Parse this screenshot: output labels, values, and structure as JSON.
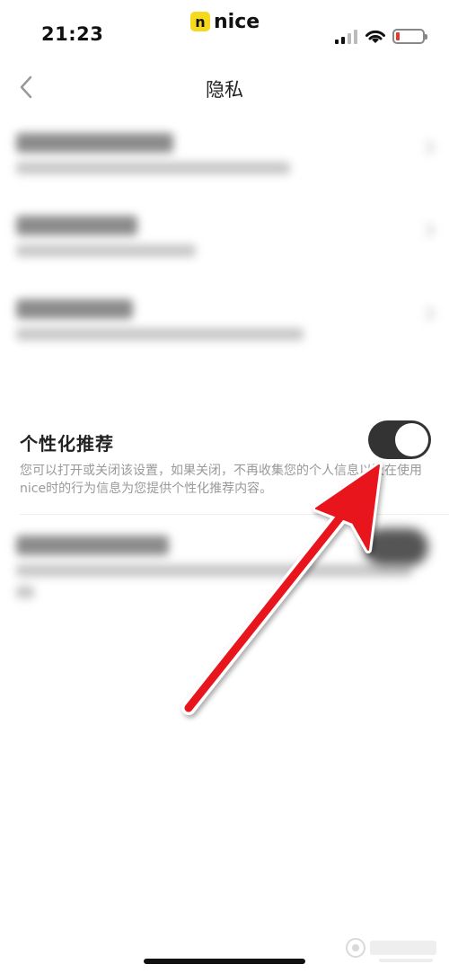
{
  "status_bar": {
    "time": "21:23",
    "logo_badge": "n",
    "logo_text": "nice"
  },
  "nav": {
    "title": "隐私"
  },
  "personalized_recommendation": {
    "title": "个性化推荐",
    "description": "您可以打开或关闭该设置，如果关闭，不再收集您的个人信息以及在使用nice时的行为信息为您提供个性化推荐内容。",
    "enabled": true
  },
  "colors": {
    "toggle_on": "#333333",
    "arrow": "#e8141c",
    "logo_yellow": "#f5d91c"
  }
}
